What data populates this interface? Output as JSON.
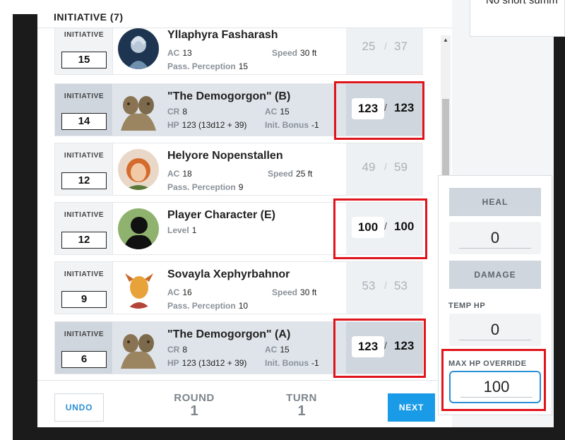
{
  "right_card": {
    "text": "No short summ"
  },
  "tracker": {
    "title": "INITIATIVE (7)",
    "init_label": "INITIATIVE",
    "rows": [
      {
        "name": "Yllaphyra Fasharash",
        "initiative": "15",
        "ac_label": "AC",
        "ac": "13",
        "speed_label": "Speed",
        "speed": "30 ft",
        "perc_label": "Pass. Perception",
        "perc": "15",
        "hp_current": "25",
        "hp_max": "37",
        "active": false,
        "highlighted": false
      },
      {
        "name": "\"The Demogorgon\" (B)",
        "initiative": "14",
        "cr_label": "CR",
        "cr": "8",
        "ac_label": "AC",
        "ac": "15",
        "hp_label": "HP",
        "hp": "123 (13d12 + 39)",
        "init_bonus_label": "Init. Bonus",
        "init_bonus": "-1",
        "hp_current": "123",
        "hp_max": "123",
        "active": true,
        "highlighted": true
      },
      {
        "name": "Helyore Nopenstallen",
        "initiative": "12",
        "ac_label": "AC",
        "ac": "18",
        "speed_label": "Speed",
        "speed": "25 ft",
        "perc_label": "Pass. Perception",
        "perc": "9",
        "hp_current": "49",
        "hp_max": "59",
        "active": false,
        "highlighted": false
      },
      {
        "name": "Player Character (E)",
        "initiative": "12",
        "level_label": "Level",
        "level": "1",
        "hp_current": "100",
        "hp_max": "100",
        "active": false,
        "highlighted": true
      },
      {
        "name": "Sovayla Xephyrbahnor",
        "initiative": "9",
        "ac_label": "AC",
        "ac": "16",
        "speed_label": "Speed",
        "speed": "30 ft",
        "perc_label": "Pass. Perception",
        "perc": "10",
        "hp_current": "53",
        "hp_max": "53",
        "active": false,
        "highlighted": false
      },
      {
        "name": "\"The Demogorgon\" (A)",
        "initiative": "6",
        "cr_label": "CR",
        "cr": "8",
        "ac_label": "AC",
        "ac": "15",
        "hp_label": "HP",
        "hp": "123 (13d12 + 39)",
        "init_bonus_label": "Init. Bonus",
        "init_bonus": "-1",
        "hp_current": "123",
        "hp_max": "123",
        "active": true,
        "highlighted": true
      }
    ],
    "hp_separator": "/"
  },
  "footer": {
    "undo_label": "UNDO",
    "round_label": "ROUND",
    "round_value": "1",
    "turn_label": "TURN",
    "turn_value": "1",
    "next_label": "NEXT"
  },
  "hp_popover": {
    "heal_label": "HEAL",
    "amount_value": "0",
    "damage_label": "DAMAGE",
    "temp_hp_label": "TEMP HP",
    "temp_hp_value": "0",
    "max_hp_override_label": "MAX HP OVERRIDE",
    "max_hp_override_value": "100"
  },
  "colors": {
    "accent": "#1a9be8",
    "highlight": "#e0141b",
    "active_row": "#cfd6de"
  }
}
